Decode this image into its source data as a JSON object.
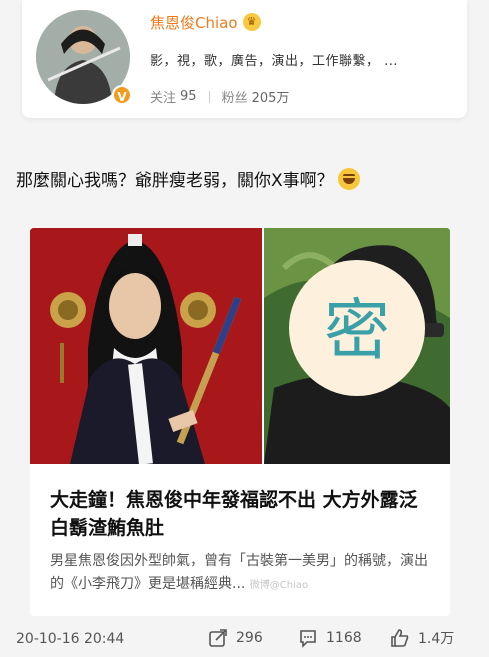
{
  "profile": {
    "name": "焦恩俊Chiao",
    "tags": "影，視，歌，廣告，演出，工作聯繫，  ...",
    "follow_label": "关注",
    "follow_count": "95",
    "fans_label": "粉丝",
    "fans_count": "205万"
  },
  "post": {
    "text": "那麼關心我嗎？爺胖瘦老弱，關你X事啊？"
  },
  "article": {
    "title": "大走鐘！焦恩俊中年發福認不出 大方外露泛白鬍渣鮪魚肚",
    "summary": "男星焦恩俊因外型帥氣，曾有「古裝第一美男」的稱號，演出的《小李飛刀》更是堪稱經典...",
    "mosaic_char": "密",
    "watermark_text": "微博@Chiao"
  },
  "footer": {
    "timestamp": "20-10-16 20:44",
    "shares": "296",
    "comments": "1168",
    "likes": "1.4万"
  },
  "colors": {
    "name": "#f07a1a",
    "verified": "#f29b1d",
    "mosaic_circle": "#fdf1dd",
    "mosaic_text": "#3aa0a8"
  }
}
